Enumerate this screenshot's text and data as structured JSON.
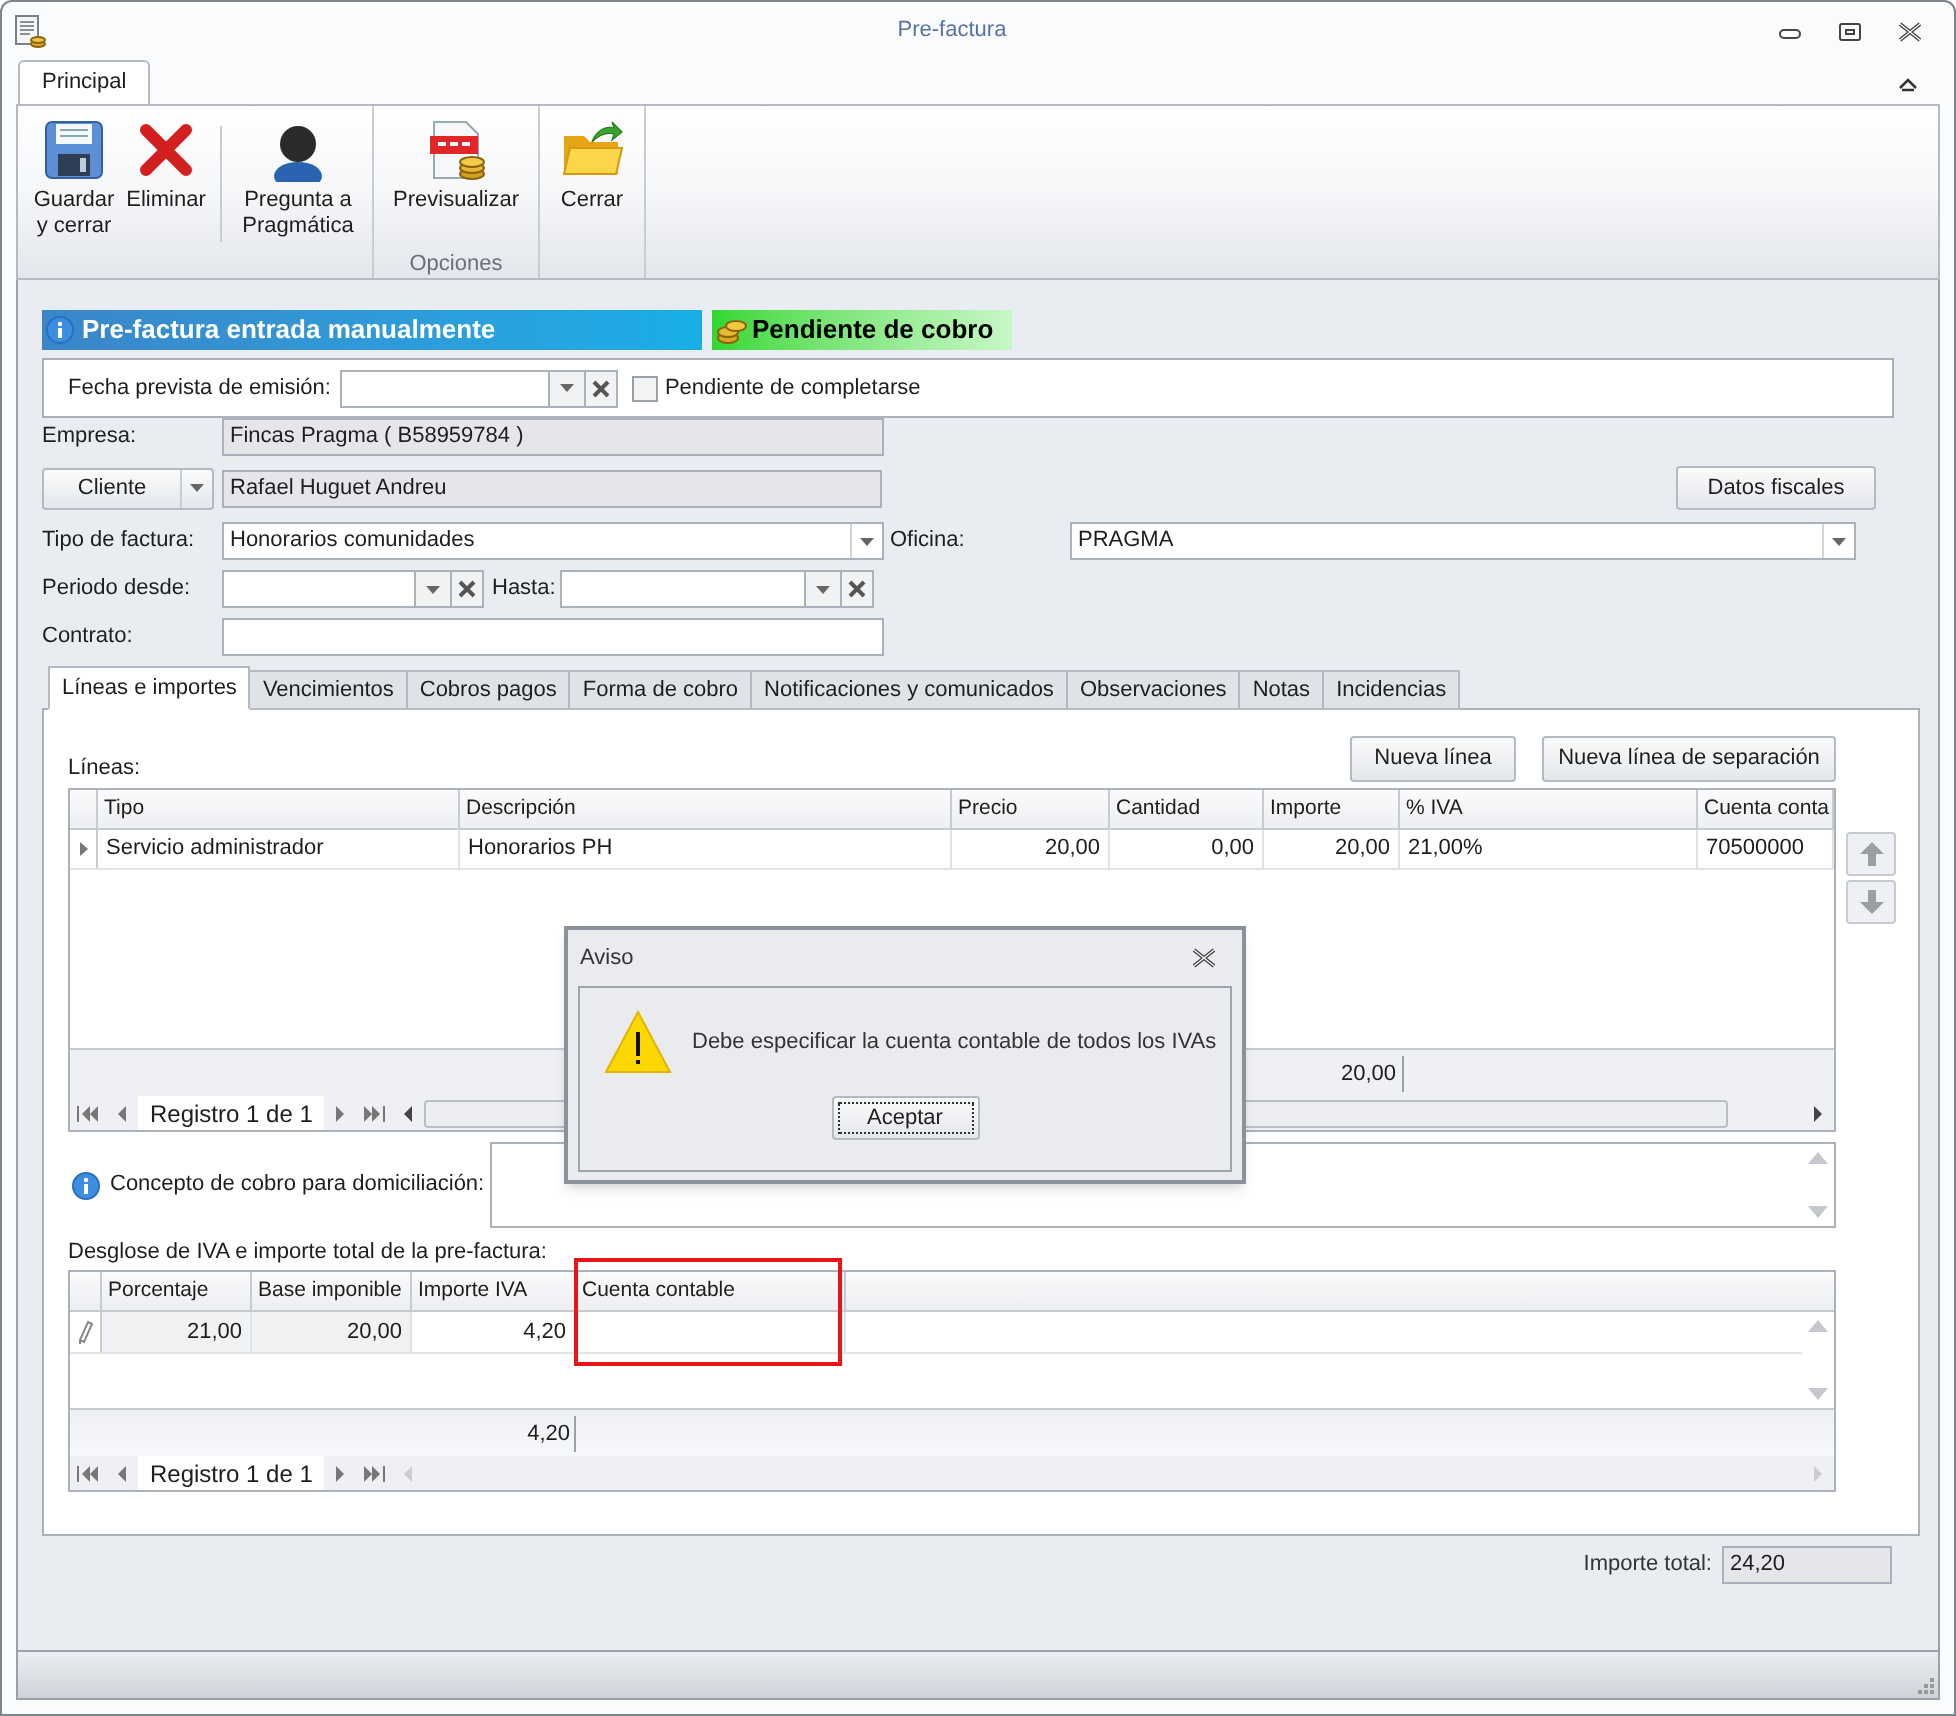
{
  "window": {
    "title": "Pre-factura"
  },
  "ribbon": {
    "tabs": [
      {
        "label": "Principal",
        "selected": true
      }
    ],
    "groups": [
      {
        "buttons": [
          {
            "label": "Guardar y cerrar",
            "separator_before": false
          },
          {
            "label": "Eliminar",
            "separator_before": false
          },
          {
            "label": "Pregunta a Pragmática",
            "separator_before": true
          }
        ]
      },
      {
        "label": "Opciones",
        "buttons": [
          {
            "label": "Previsualizar",
            "separator_before": false
          }
        ]
      },
      {
        "buttons": [
          {
            "label": "Cerrar",
            "separator_before": false
          }
        ]
      }
    ]
  },
  "banner": {
    "info": "Pre-factura entrada manualmente",
    "status": "Pendiente de cobro"
  },
  "emision": {
    "label": "Fecha prevista de emisión:",
    "checkbox": {
      "label": "Pendiente de completarse",
      "checked": false
    }
  },
  "empresa": {
    "label": "Empresa:",
    "value": "Fincas Pragma ( B58959784 )"
  },
  "cliente": {
    "button": "Cliente",
    "value": "Rafael Huguet Andreu"
  },
  "datos_fiscales_button": "Datos fiscales",
  "tipo_factura": {
    "label": "Tipo de factura:",
    "value": "Honorarios comunidades"
  },
  "oficina": {
    "label": "Oficina:",
    "value": "PRAGMA"
  },
  "periodo_desde": {
    "label": "Periodo desde:"
  },
  "hasta": {
    "label": "Hasta:"
  },
  "contrato": {
    "label": "Contrato:"
  },
  "tabs": [
    {
      "label": "Líneas e importes",
      "selected": true
    },
    {
      "label": "Vencimientos",
      "selected": false
    },
    {
      "label": "Cobros pagos",
      "selected": false
    },
    {
      "label": "Forma de cobro",
      "selected": false
    },
    {
      "label": "Notificaciones y comunicados",
      "selected": false
    },
    {
      "label": "Observaciones",
      "selected": false
    },
    {
      "label": "Notas",
      "selected": false
    },
    {
      "label": "Incidencias",
      "selected": false
    }
  ],
  "lineas": {
    "label": "Líneas:",
    "buttons": [
      "Nueva línea",
      "Nueva línea de separación"
    ],
    "columns": [
      "Tipo",
      "Descripción",
      "Precio",
      "Cantidad",
      "Importe",
      "% IVA",
      "Cuenta conta"
    ],
    "rows": [
      {
        "cells": [
          "Servicio administrador",
          "Honorarios PH",
          "20,00",
          "0,00",
          "20,00",
          "21,00%",
          "70500000"
        ]
      }
    ],
    "footer_importe": "20,00",
    "navigator": "Registro 1 de 1"
  },
  "concepto": {
    "label": "Concepto de cobro para domiciliación:"
  },
  "desglose": {
    "label": "Desglose de IVA e importe total de la pre-factura:",
    "columns": [
      {
        "label": "Porcentaje",
        "highlighted": false
      },
      {
        "label": "Base imponible",
        "highlighted": false
      },
      {
        "label": "Importe IVA",
        "highlighted": false
      },
      {
        "label": "Cuenta contable",
        "highlighted": true
      }
    ],
    "rows": [
      {
        "cells": [
          "21,00",
          "20,00",
          "4,20"
        ]
      }
    ],
    "footer_importe_iva": "4,20",
    "navigator": "Registro 1 de 1"
  },
  "importe_total": {
    "label": "Importe total:",
    "value": "24,20"
  },
  "dialog": {
    "title": "Aviso",
    "message": "Debe especificar la cuenta contable de todos los IVAs",
    "button": "Aceptar"
  }
}
